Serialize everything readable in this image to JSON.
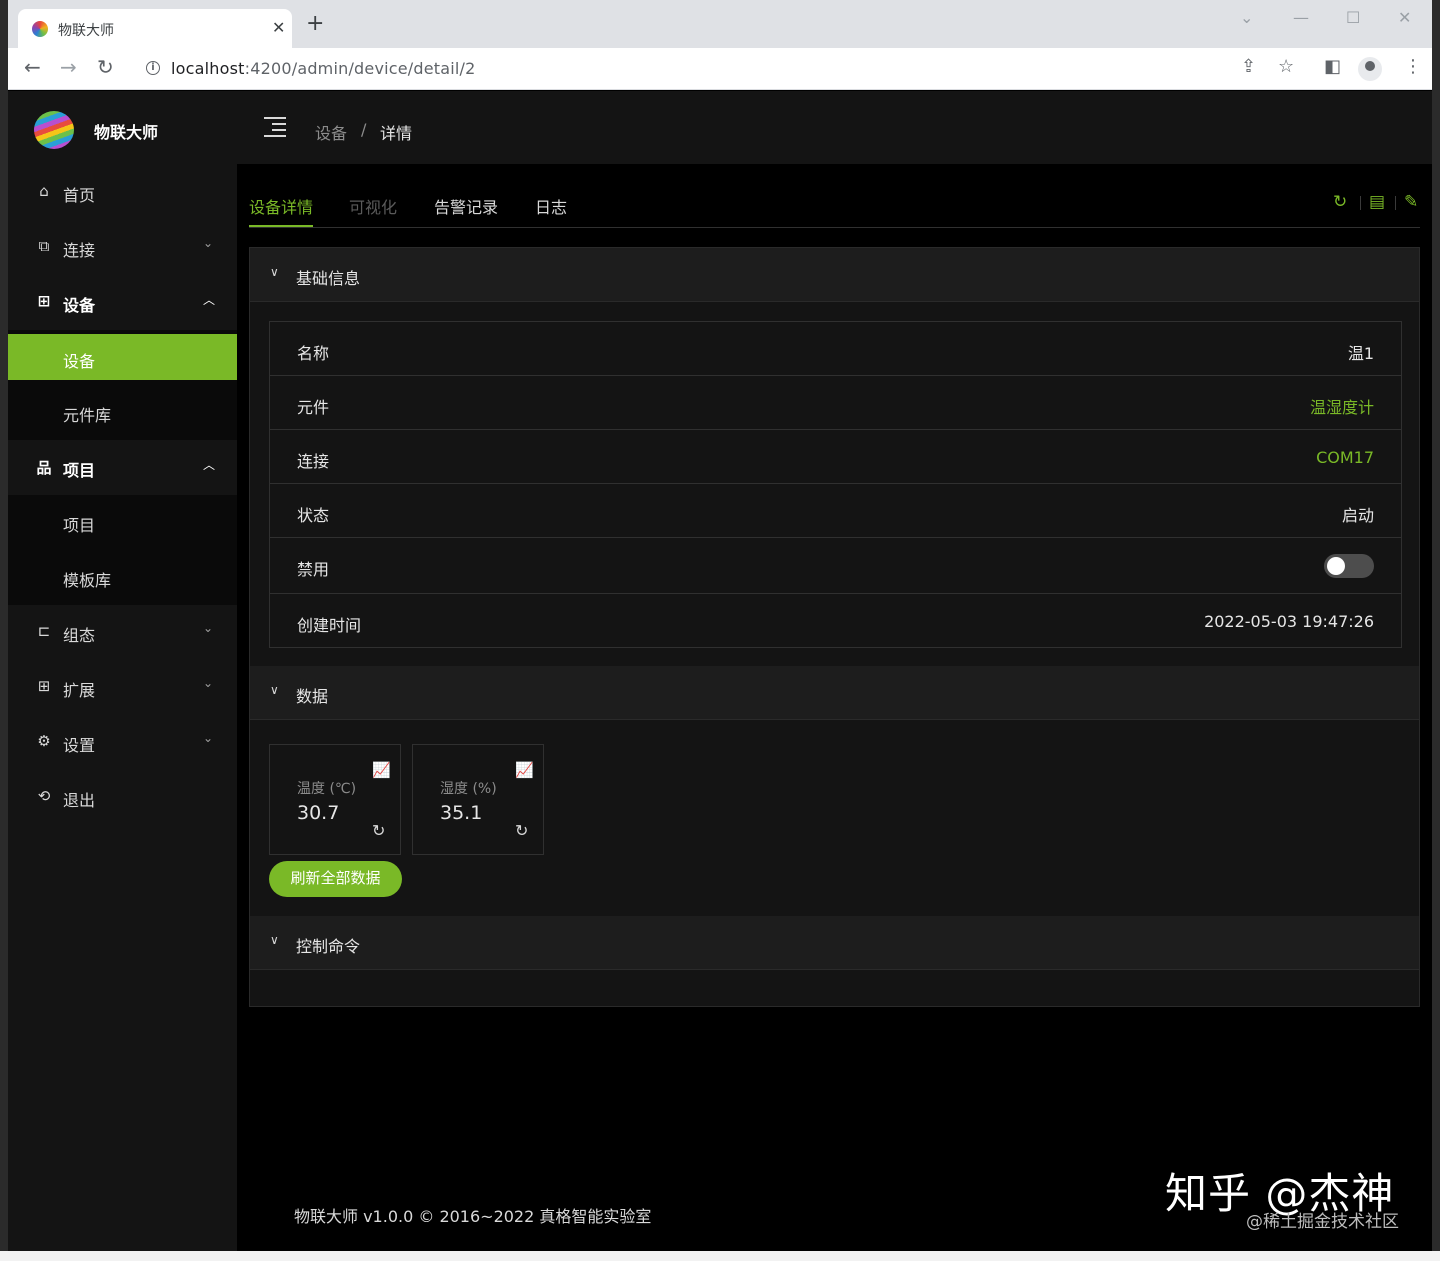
{
  "browser": {
    "tab_title": "物联大师",
    "url_host": "localhost",
    "url_path": ":4200/admin/device/detail/2"
  },
  "sidebar": {
    "brand": "物联大师",
    "items": [
      {
        "label": "首页",
        "icon": "home-icon"
      },
      {
        "label": "连接",
        "icon": "link-icon"
      },
      {
        "label": "设备",
        "icon": "grid-icon"
      },
      {
        "label": "项目",
        "icon": "cluster-icon"
      },
      {
        "label": "组态",
        "icon": "block-icon"
      },
      {
        "label": "扩展",
        "icon": "apps-icon"
      },
      {
        "label": "设置",
        "icon": "gear-icon"
      },
      {
        "label": "退出",
        "icon": "logout-icon"
      }
    ],
    "device_sub": [
      "设备",
      "元件库"
    ],
    "project_sub": [
      "项目",
      "模板库"
    ]
  },
  "breadcrumb": [
    "设备",
    "详情"
  ],
  "tabs": [
    "设备详情",
    "可视化",
    "告警记录",
    "日志"
  ],
  "basic": {
    "title": "基础信息",
    "rows": [
      {
        "k": "名称",
        "v": "温1"
      },
      {
        "k": "元件",
        "v": "温湿度计"
      },
      {
        "k": "连接",
        "v": "COM17"
      },
      {
        "k": "状态",
        "v": "启动"
      },
      {
        "k": "禁用",
        "v": ""
      },
      {
        "k": "创建时间",
        "v": "2022-05-03 19:47:26"
      }
    ],
    "disabled": false
  },
  "data_panel": {
    "title": "数据",
    "cards": [
      {
        "label": "温度 (℃)",
        "value": "30.7"
      },
      {
        "label": "湿度 (%)",
        "value": "35.1"
      }
    ],
    "refresh_label": "刷新全部数据"
  },
  "control": {
    "title": "控制命令"
  },
  "footer": "物联大师 v1.0.0 © 2016~2022 真格智能实验室",
  "watermark": {
    "main": "知乎 @杰神",
    "sub": "@稀土掘金技术社区"
  },
  "colors": {
    "accent": "#7ab927",
    "bg": "#000000",
    "sider": "#141414"
  }
}
